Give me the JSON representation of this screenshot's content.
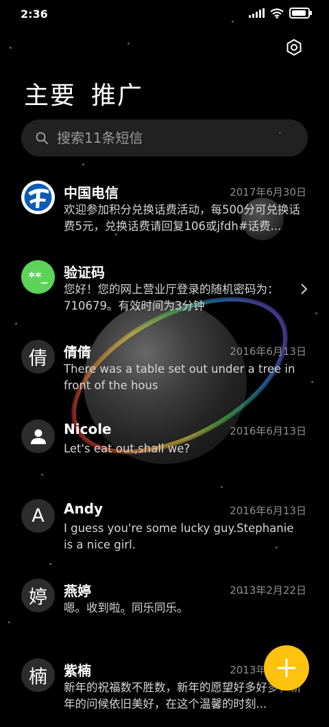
{
  "status_bar": {
    "time": "2:36"
  },
  "tabs": [
    {
      "label": "主要"
    },
    {
      "label": "推广"
    }
  ],
  "search": {
    "placeholder": "搜索11条短信"
  },
  "conversations": [
    {
      "name": "中国电信",
      "date": "2017年6月30日",
      "preview": "欢迎参加积分兑换话费活动，每500分可兑换话费5元，兑换话费请回复106或jfdh#话费...",
      "avatar": "china-telecom-logo"
    },
    {
      "name": "验证码",
      "date": "",
      "preview": "您好！您的网上营业厅登录的随机密码为：710679。有效时间为3分钟",
      "avatar": "**_"
    },
    {
      "name": "倩倩",
      "date": "2016年6月13日",
      "preview": "There was a table set out under a tree in front of the hous",
      "avatar": "倩"
    },
    {
      "name": "Nicole",
      "date": "2016年6月13日",
      "preview": "Let's eat out,shall we?",
      "avatar": "person-icon"
    },
    {
      "name": "Andy",
      "date": "2016年6月13日",
      "preview": "I guess you're some lucky guy.Stephanie is a nice girl.",
      "avatar": "A"
    },
    {
      "name": "燕婷",
      "date": "2013年2月22日",
      "preview": "嗯。收到啦。同乐同乐。",
      "avatar": "婷"
    },
    {
      "name": "紫楠",
      "date": "2013年2月22日",
      "preview": "新年的祝福数不胜数，新年的愿望好多好多，新年的问候依旧美好，在这个温馨的时刻...",
      "avatar": "楠"
    }
  ],
  "colors": {
    "accent": "#ffc20e",
    "verify_avatar": "#5dd35a",
    "telecom_blue": "#0a5bb5"
  },
  "icons": {
    "settings": "gear-icon",
    "search": "search-icon",
    "fab": "plus-icon"
  }
}
